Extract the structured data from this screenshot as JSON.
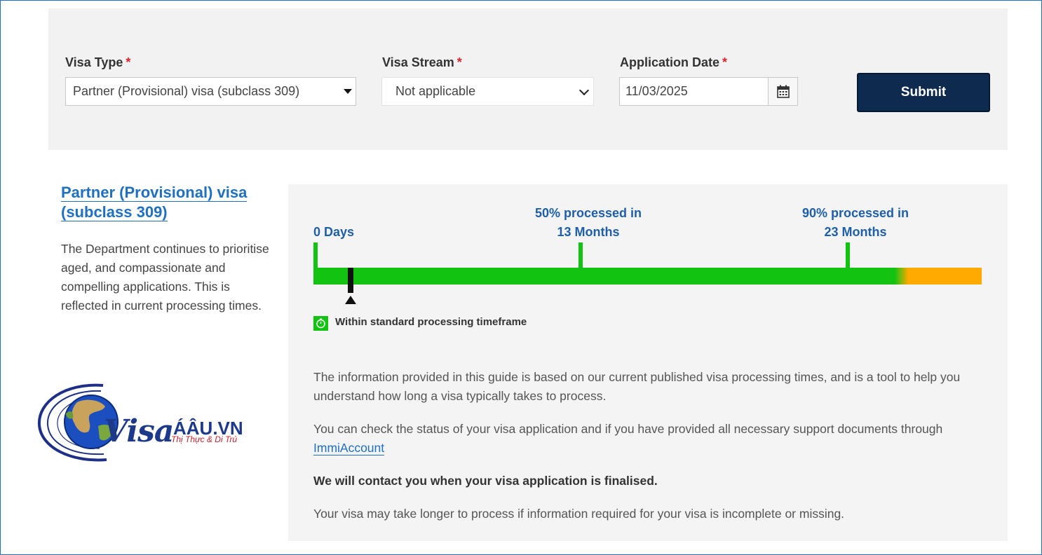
{
  "form": {
    "visa_type_label": "Visa Type",
    "visa_stream_label": "Visa Stream",
    "application_date_label": "Application Date",
    "required_mark": "*",
    "visa_type_value": "Partner (Provisional) visa (subclass 309)",
    "visa_stream_value": "Not applicable",
    "application_date_value": "11/03/2025",
    "submit_label": "Submit"
  },
  "visa_info": {
    "title": "Partner (Provisional) visa (subclass 309)",
    "description": "The Department continues to prioritise aged, and compassionate and compelling applications. This is reflected in current processing times."
  },
  "timeline": {
    "start_label": "0 Days",
    "p50_line1": "50% processed in",
    "p50_line2": "13 Months",
    "p90_line1": "90% processed in",
    "p90_line2": "23 Months",
    "status_text": "Within standard processing timeframe",
    "colors": {
      "within": "#12c312",
      "beyond": "#ffaa00",
      "marker": "#111111"
    }
  },
  "info": {
    "para1": "The information provided in this guide is based on our current published visa processing times, and is a tool to help you understand how long a visa typically takes to process.",
    "para2_text": "You can check the status of your visa application and if you have provided all necessary support documents through",
    "para2_link": "ImmiAccount",
    "para3": "We will contact you when your visa application is finalised.",
    "para4": "Your visa may take longer to process if information required for your visa is incomplete or missing."
  },
  "logo": {
    "text": "Visa",
    "suffix": "ÁÂU.VN",
    "subtitle": "Thị Thực & Di Trú"
  },
  "icons": [
    "calendar-icon",
    "dropdown-caret-icon",
    "chevron-down-icon",
    "clock-check-icon",
    "globe-icon"
  ]
}
